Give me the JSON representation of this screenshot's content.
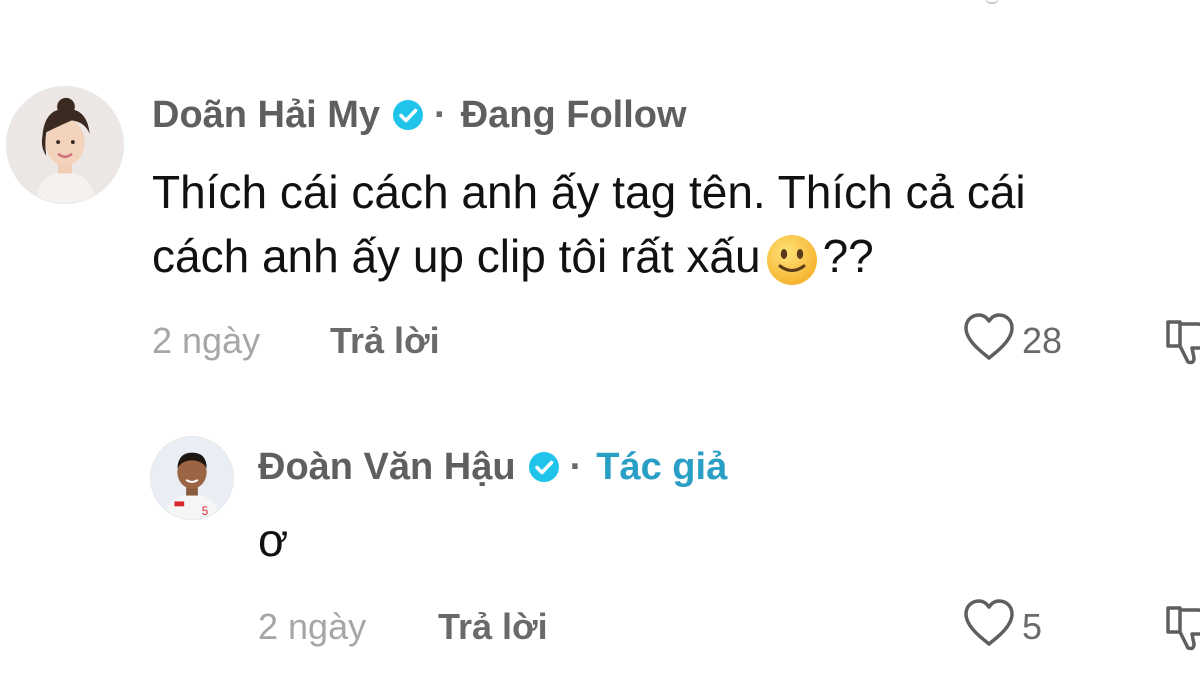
{
  "comments": [
    {
      "username": "Doãn Hải My",
      "verified": true,
      "tag": "Đang Follow",
      "text_line1": "Thích cái cách anh ấy tag tên. Thích cả cái",
      "text_line2_before": "cách anh ấy up clip tôi rất xấu",
      "emoji": "slightly-smiling-face",
      "text_line2_after": "??",
      "time": "2 ngày",
      "reply_label": "Trả lời",
      "likes": "28"
    },
    {
      "username": "Đoàn Văn Hậu",
      "verified": true,
      "tag": "Tác giả",
      "text": "ơ",
      "time": "2 ngày",
      "reply_label": "Trả lời",
      "likes": "5"
    }
  ],
  "colors": {
    "verified_badge": "#20c4ea",
    "author_tag": "#2a9fc5",
    "username": "#5f5f5f",
    "body_text": "#111111",
    "meta_text": "#a6a6a6"
  }
}
